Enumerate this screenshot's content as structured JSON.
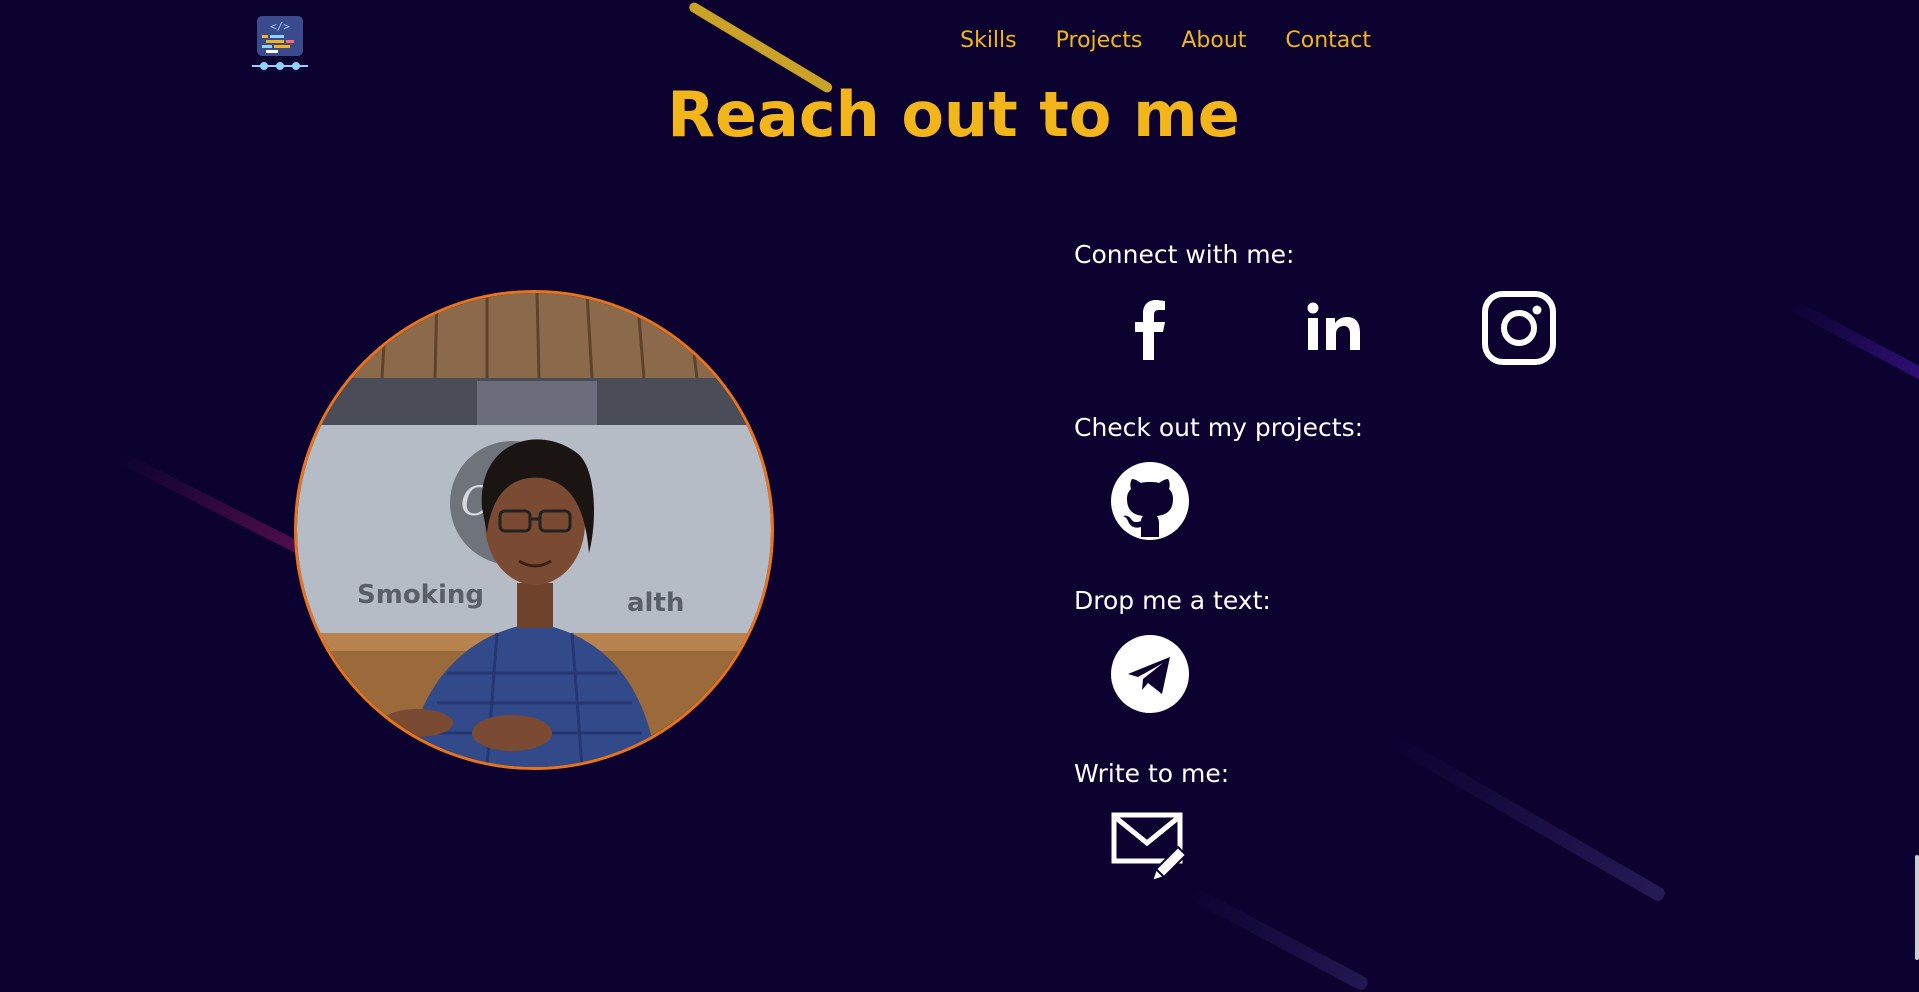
{
  "nav": {
    "items": [
      {
        "label": "Skills"
      },
      {
        "label": "Projects"
      },
      {
        "label": "About"
      },
      {
        "label": "Contact"
      }
    ]
  },
  "page": {
    "title": "Reach out to me"
  },
  "sections": {
    "connect": {
      "label": "Connect with me:",
      "icons": [
        "facebook-icon",
        "linkedin-icon",
        "instagram-icon"
      ]
    },
    "projects": {
      "label": "Check out my projects:",
      "icons": [
        "github-icon"
      ]
    },
    "text": {
      "label": "Drop me a text:",
      "icons": [
        "telegram-icon"
      ]
    },
    "write": {
      "label": "Write to me:",
      "icons": [
        "mail-icon"
      ]
    }
  },
  "colors": {
    "background": "#0b0230",
    "accent": "#f2b61a",
    "photo_border": "#e8731d",
    "label_text": "#ffffff"
  }
}
